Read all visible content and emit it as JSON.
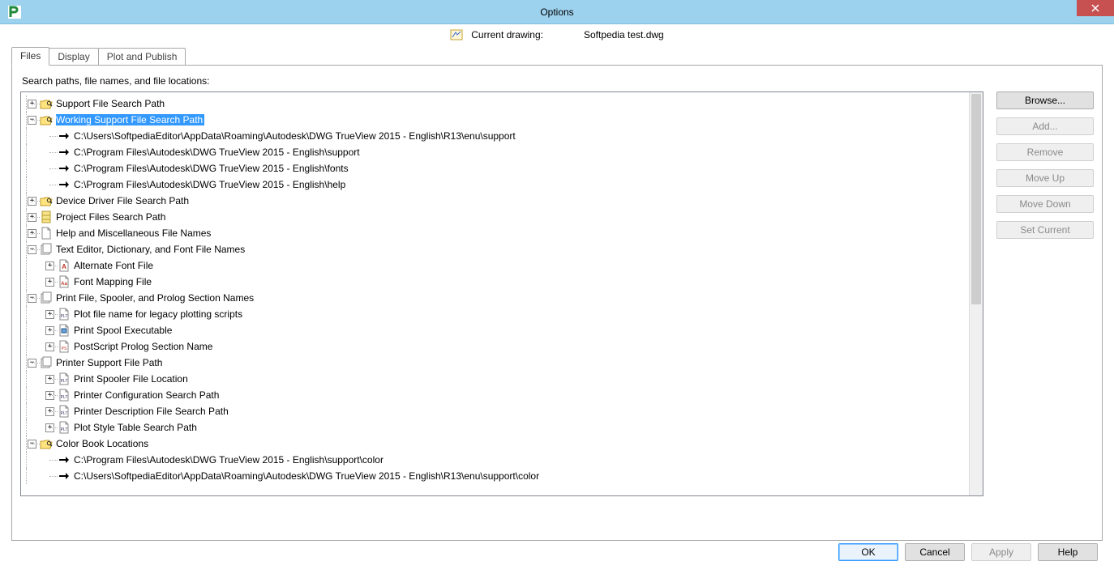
{
  "window": {
    "title": "Options"
  },
  "header": {
    "current_drawing_label": "Current drawing:",
    "current_drawing_value": "Softpedia test.dwg"
  },
  "tabs": [
    {
      "label": "Files",
      "active": true
    },
    {
      "label": "Display",
      "active": false
    },
    {
      "label": "Plot and Publish",
      "active": false
    }
  ],
  "panel": {
    "heading": "Search paths, file names, and file locations:"
  },
  "side_buttons": [
    {
      "label": "Browse...",
      "enabled": true
    },
    {
      "label": "Add...",
      "enabled": false
    },
    {
      "label": "Remove",
      "enabled": false
    },
    {
      "label": "Move Up",
      "enabled": false
    },
    {
      "label": "Move Down",
      "enabled": false
    },
    {
      "label": "Set Current",
      "enabled": false
    }
  ],
  "bottom_buttons": [
    {
      "label": "OK",
      "enabled": true,
      "default": true
    },
    {
      "label": "Cancel",
      "enabled": true,
      "default": false
    },
    {
      "label": "Apply",
      "enabled": false,
      "default": false
    },
    {
      "label": "Help",
      "enabled": true,
      "default": false
    }
  ],
  "tree": [
    {
      "depth": 0,
      "icon": "folder-search-open",
      "label": "Support File Search Path",
      "expander": "+",
      "selected": false
    },
    {
      "depth": 0,
      "icon": "folder-search-open",
      "label": "Working Support File Search Path",
      "expander": "-",
      "selected": true
    },
    {
      "depth": 1,
      "icon": "path-arrow",
      "label": "C:\\Users\\SoftpediaEditor\\AppData\\Roaming\\Autodesk\\DWG TrueView 2015 - English\\R13\\enu\\support",
      "expander": "",
      "selected": false
    },
    {
      "depth": 1,
      "icon": "path-arrow",
      "label": "C:\\Program Files\\Autodesk\\DWG TrueView 2015 - English\\support",
      "expander": "",
      "selected": false
    },
    {
      "depth": 1,
      "icon": "path-arrow",
      "label": "C:\\Program Files\\Autodesk\\DWG TrueView 2015 - English\\fonts",
      "expander": "",
      "selected": false
    },
    {
      "depth": 1,
      "icon": "path-arrow",
      "label": "C:\\Program Files\\Autodesk\\DWG TrueView 2015 - English\\help",
      "expander": "",
      "selected": false
    },
    {
      "depth": 0,
      "icon": "folder-search-open",
      "label": "Device Driver File Search Path",
      "expander": "+",
      "selected": false
    },
    {
      "depth": 0,
      "icon": "file-cabinet",
      "label": "Project Files Search Path",
      "expander": "+",
      "selected": false
    },
    {
      "depth": 0,
      "icon": "file",
      "label": "Help and Miscellaneous File Names",
      "expander": "+",
      "selected": false
    },
    {
      "depth": 0,
      "icon": "file-stack",
      "label": "Text Editor, Dictionary, and Font File Names",
      "expander": "-",
      "selected": false
    },
    {
      "depth": 1,
      "icon": "font-file",
      "label": "Alternate Font File",
      "expander": "+",
      "selected": false
    },
    {
      "depth": 1,
      "icon": "font-map-file",
      "label": "Font Mapping File",
      "expander": "+",
      "selected": false
    },
    {
      "depth": 0,
      "icon": "file-stack",
      "label": "Print File, Spooler, and Prolog Section Names",
      "expander": "-",
      "selected": false
    },
    {
      "depth": 1,
      "icon": "plt-file",
      "label": "Plot file name for legacy plotting scripts",
      "expander": "+",
      "selected": false
    },
    {
      "depth": 1,
      "icon": "exe-file",
      "label": "Print Spool Executable",
      "expander": "+",
      "selected": false
    },
    {
      "depth": 1,
      "icon": "ps-file",
      "label": "PostScript Prolog Section Name",
      "expander": "+",
      "selected": false
    },
    {
      "depth": 0,
      "icon": "file-stack",
      "label": "Printer Support File Path",
      "expander": "-",
      "selected": false
    },
    {
      "depth": 1,
      "icon": "plt-file",
      "label": "Print Spooler File Location",
      "expander": "+",
      "selected": false
    },
    {
      "depth": 1,
      "icon": "plt-file",
      "label": "Printer Configuration Search Path",
      "expander": "+",
      "selected": false
    },
    {
      "depth": 1,
      "icon": "plt-file",
      "label": "Printer Description File Search Path",
      "expander": "+",
      "selected": false
    },
    {
      "depth": 1,
      "icon": "plt-file",
      "label": "Plot Style Table Search Path",
      "expander": "+",
      "selected": false
    },
    {
      "depth": 0,
      "icon": "folder-search-open",
      "label": "Color Book Locations",
      "expander": "-",
      "selected": false
    },
    {
      "depth": 1,
      "icon": "path-arrow",
      "label": "C:\\Program Files\\Autodesk\\DWG TrueView 2015 - English\\support\\color",
      "expander": "",
      "selected": false
    },
    {
      "depth": 1,
      "icon": "path-arrow",
      "label": "C:\\Users\\SoftpediaEditor\\AppData\\Roaming\\Autodesk\\DWG TrueView 2015 - English\\R13\\enu\\support\\color",
      "expander": "",
      "selected": false
    }
  ]
}
